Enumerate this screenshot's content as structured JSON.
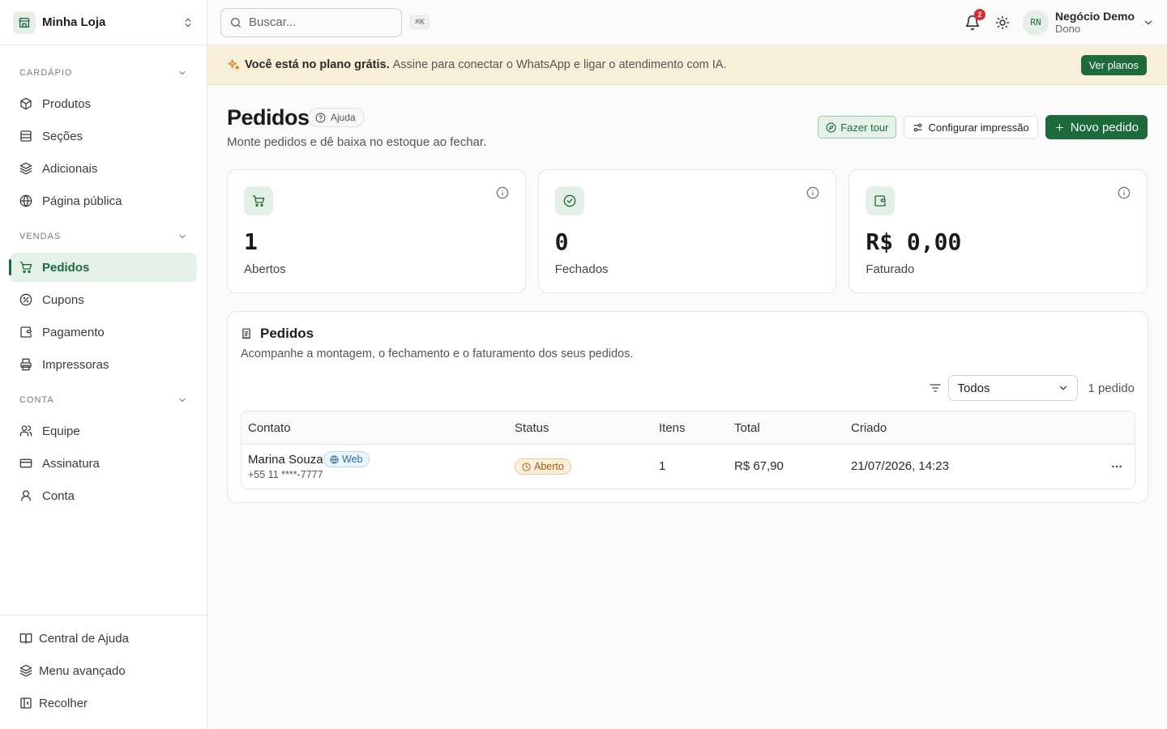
{
  "sidebar": {
    "store_name": "Minha Loja",
    "groups": [
      {
        "title": "CARDÁPIO",
        "items": [
          {
            "label": "Produtos",
            "icon": "package-icon"
          },
          {
            "label": "Seções",
            "icon": "sections-icon"
          },
          {
            "label": "Adicionais",
            "icon": "layers-icon"
          },
          {
            "label": "Página pública",
            "icon": "globe-icon"
          }
        ]
      },
      {
        "title": "VENDAS",
        "items": [
          {
            "label": "Pedidos",
            "icon": "cart-icon",
            "active": true
          },
          {
            "label": "Cupons",
            "icon": "coupon-icon"
          },
          {
            "label": "Pagamento",
            "icon": "wallet-icon"
          },
          {
            "label": "Impressoras",
            "icon": "printer-icon"
          }
        ]
      },
      {
        "title": "CONTA",
        "items": [
          {
            "label": "Equipe",
            "icon": "users-icon"
          },
          {
            "label": "Assinatura",
            "icon": "credit-card-icon"
          },
          {
            "label": "Conta",
            "icon": "user-icon"
          }
        ]
      }
    ],
    "footer": [
      {
        "label": "Central de Ajuda",
        "icon": "book-icon"
      },
      {
        "label": "Menu avançado",
        "icon": "layers-icon"
      },
      {
        "label": "Recolher",
        "icon": "collapse-icon"
      }
    ]
  },
  "topbar": {
    "search_placeholder": "Buscar...",
    "search_shortcut": "⌘K",
    "notifications_count": "2",
    "user_initials": "RN",
    "user_name": "Negócio Demo",
    "user_role": "Dono"
  },
  "banner": {
    "strong": "Você está no plano grátis.",
    "text": "Assine para conectar o WhatsApp e ligar o atendimento com IA.",
    "button": "Ver planos"
  },
  "page": {
    "title": "Pedidos",
    "help_label": "Ajuda",
    "subtitle": "Monte pedidos e dê baixa no estoque ao fechar.",
    "tour_button": "Fazer tour",
    "print_button": "Configurar impressão",
    "new_button": "Novo pedido"
  },
  "stats": [
    {
      "value": "1",
      "label": "Abertos",
      "icon": "cart-icon"
    },
    {
      "value": "0",
      "label": "Fechados",
      "icon": "check-circle-icon"
    },
    {
      "value": "R$ 0,00",
      "label": "Faturado",
      "icon": "wallet-icon"
    }
  ],
  "orders": {
    "title": "Pedidos",
    "subtitle": "Acompanhe a montagem, o fechamento e o faturamento dos seus pedidos.",
    "filter_value": "Todos",
    "count_label": "1 pedido",
    "columns": [
      "Contato",
      "Status",
      "Itens",
      "Total",
      "Criado"
    ],
    "rows": [
      {
        "contact_name": "Marina Souza",
        "channel": "Web",
        "phone": "+55 11 ****-7777",
        "status": "Aberto",
        "items": "1",
        "total": "R$ 67,90",
        "created": "21/07/2026, 14:23"
      }
    ]
  },
  "colors": {
    "brand": "#1d6a3a",
    "brand_soft": "#e4f1e8",
    "banner_bg": "#f8efd9",
    "status_open": "#b2560c",
    "channel_web": "#2a6d9e",
    "badge_red": "#d92d2d"
  }
}
